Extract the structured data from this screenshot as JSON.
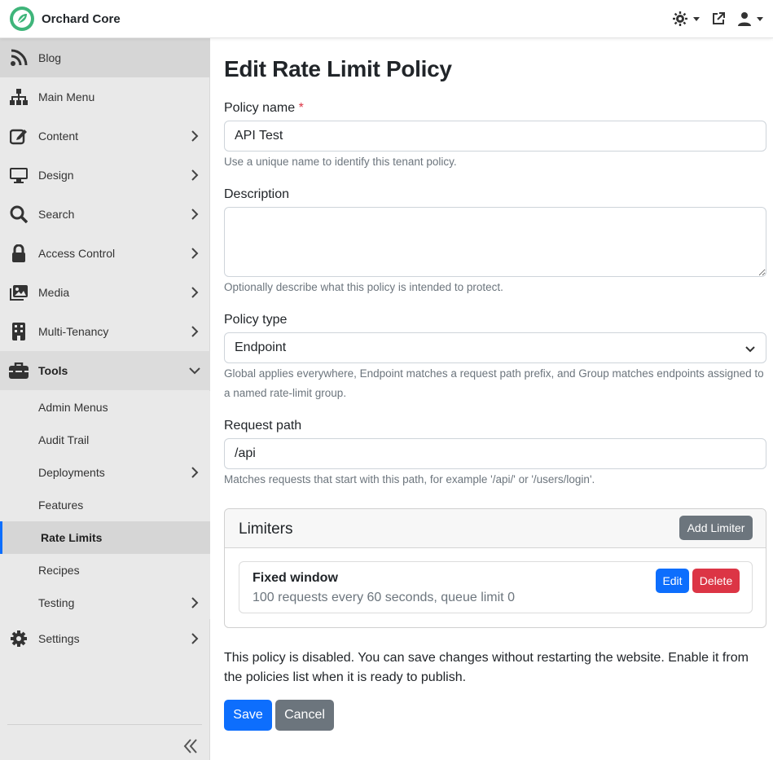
{
  "app": {
    "brand_name": "Orchard Core",
    "brand_color": "#3fb57a"
  },
  "topbar": {
    "theme_icon": "sun-gear-icon",
    "external_icon": "external-link-icon",
    "user_icon": "user-icon"
  },
  "sidebar": {
    "items": [
      {
        "label": "Blog",
        "icon": "rss-icon"
      },
      {
        "label": "Main Menu",
        "icon": "sitemap-icon"
      },
      {
        "label": "Content",
        "icon": "edit-icon"
      },
      {
        "label": "Design",
        "icon": "monitor-icon"
      },
      {
        "label": "Search",
        "icon": "search-icon"
      },
      {
        "label": "Access Control",
        "icon": "lock-icon"
      },
      {
        "label": "Media",
        "icon": "images-icon"
      },
      {
        "label": "Multi-Tenancy",
        "icon": "building-icon"
      },
      {
        "label": "Tools",
        "icon": "toolbox-icon"
      },
      {
        "label": "Settings",
        "icon": "gear-icon"
      }
    ],
    "tools_sub": [
      {
        "label": "Admin Menus"
      },
      {
        "label": "Audit Trail"
      },
      {
        "label": "Deployments"
      },
      {
        "label": "Features"
      },
      {
        "label": "Rate Limits"
      },
      {
        "label": "Recipes"
      },
      {
        "label": "Testing"
      }
    ]
  },
  "form": {
    "title": "Edit Rate Limit Policy",
    "policy_name_label": "Policy name",
    "required_mark": "*",
    "policy_name_value": "API Test",
    "policy_name_help": "Use a unique name to identify this tenant policy.",
    "description_label": "Description",
    "description_value": "",
    "description_help": "Optionally describe what this policy is intended to protect.",
    "policy_type_label": "Policy type",
    "policy_type_value": "Endpoint",
    "policy_type_help": "Global applies everywhere, Endpoint matches a request path prefix, and Group matches endpoints assigned to a named rate-limit group.",
    "request_path_label": "Request path",
    "request_path_value": "/api",
    "request_path_help": "Matches requests that start with this path, for example '/api/' or '/users/login'."
  },
  "limiters": {
    "title": "Limiters",
    "add_label": "Add Limiter",
    "items": [
      {
        "name": "Fixed window",
        "description": "100 requests every 60 seconds, queue limit 0",
        "edit_label": "Edit",
        "delete_label": "Delete"
      }
    ]
  },
  "notice": "This policy is disabled. You can save changes without restarting the website. Enable it from the policies list when it is ready to publish.",
  "actions": {
    "save_label": "Save",
    "cancel_label": "Cancel"
  }
}
